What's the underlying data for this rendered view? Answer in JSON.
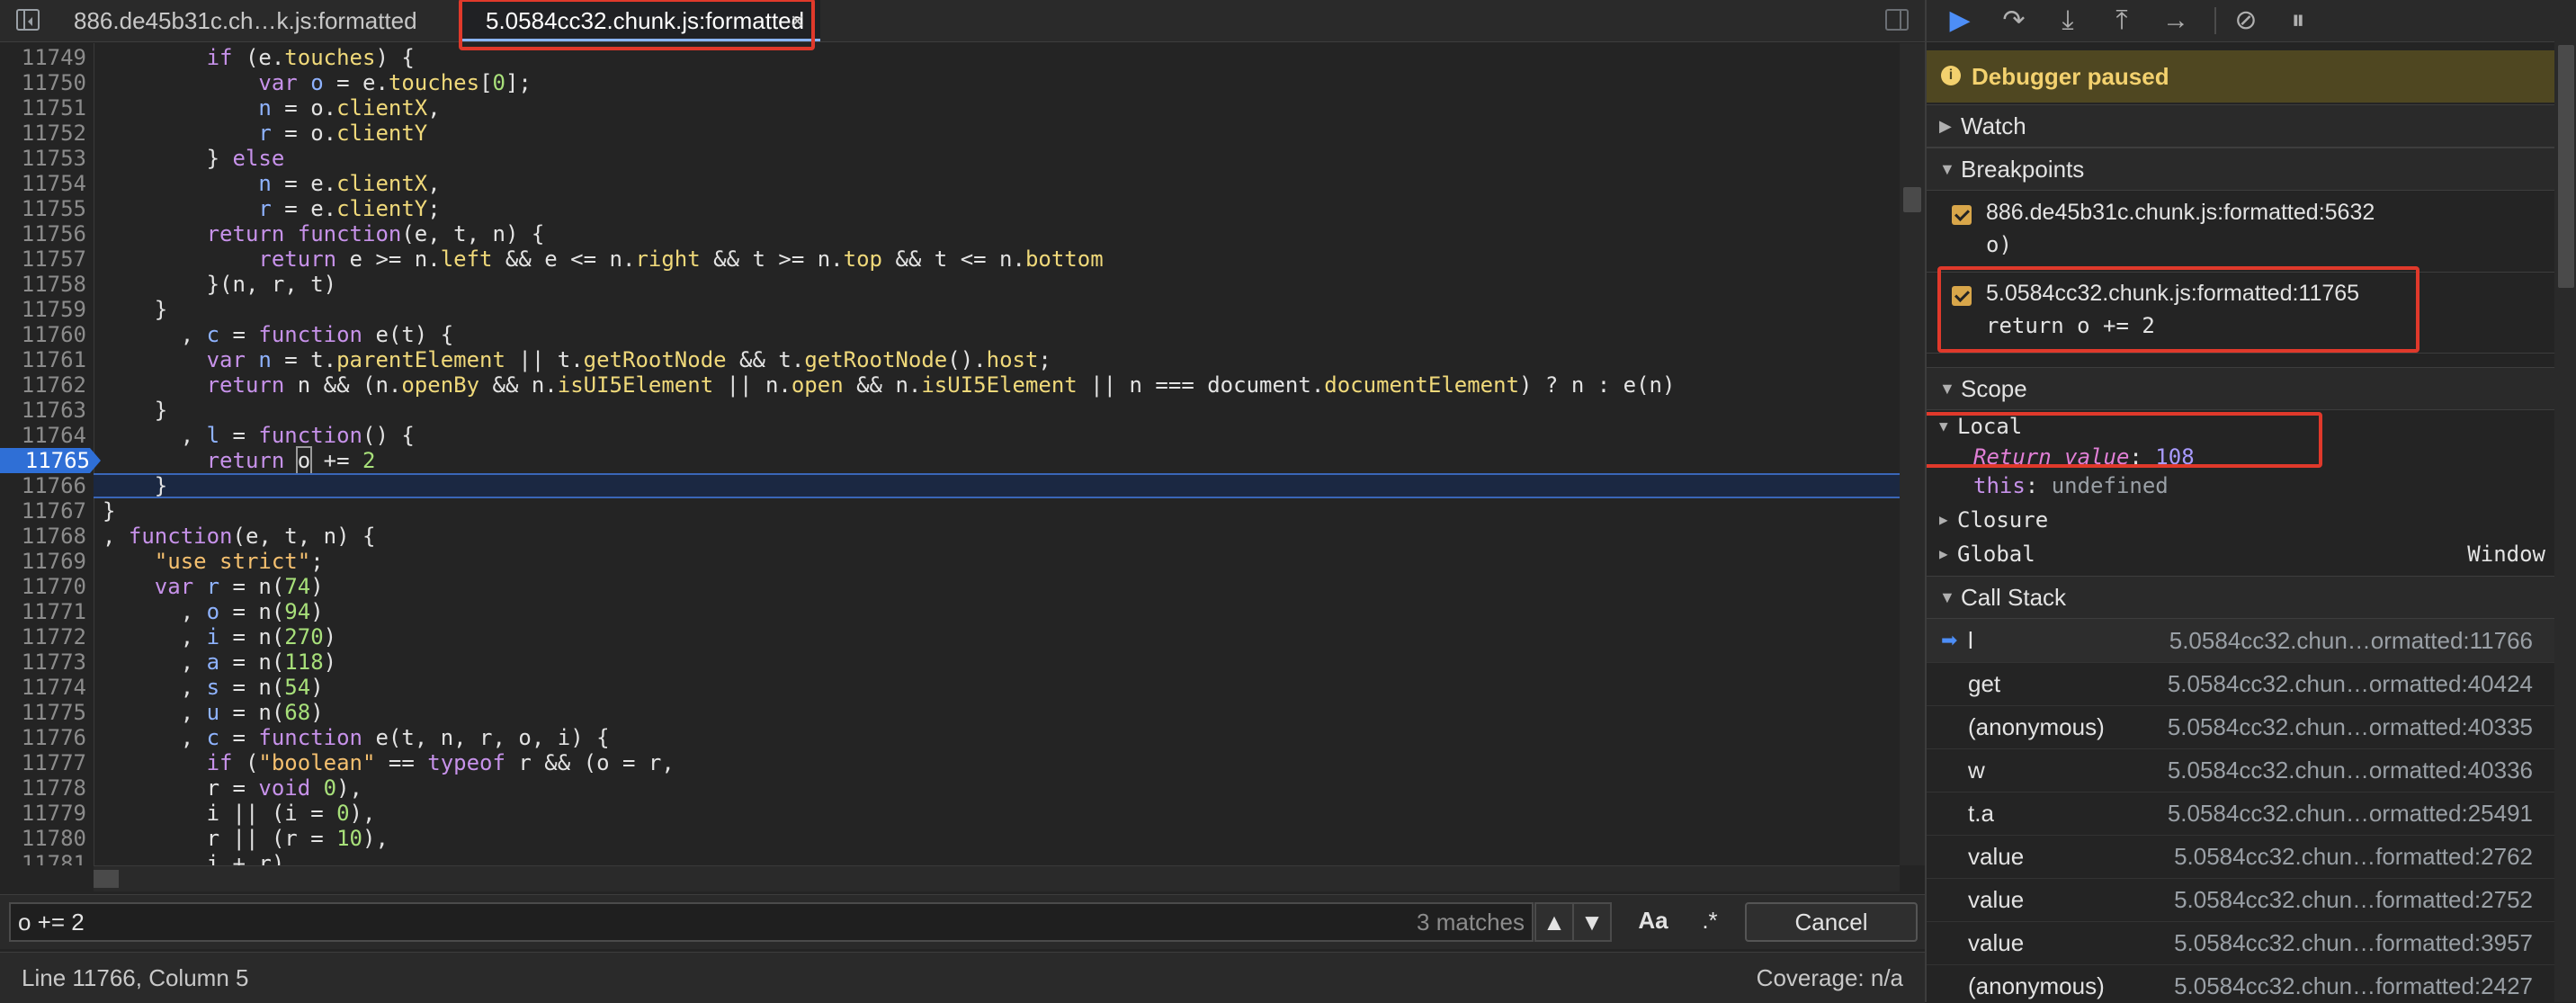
{
  "editor": {
    "tabs": [
      {
        "label": "886.de45b31c.ch…k.js:formatted"
      },
      {
        "label": "5.0584cc32.chunk.js:formatted",
        "close_label": "×"
      }
    ],
    "lines": [
      {
        "n": "11749",
        "html": "        <span class=\"kw\">if</span> (e.<span class=\"prop\">touches</span>) {"
      },
      {
        "n": "11750",
        "html": "            <span class=\"kw\">var</span> <span class=\"var\">o</span> = e.<span class=\"prop\">touches</span>[<span class=\"num\">0</span>];"
      },
      {
        "n": "11751",
        "html": "            <span class=\"var\">n</span> = o.<span class=\"prop\">clientX</span>,"
      },
      {
        "n": "11752",
        "html": "            <span class=\"var\">r</span> = o.<span class=\"prop\">clientY</span>"
      },
      {
        "n": "11753",
        "html": "        } <span class=\"kw\">else</span>"
      },
      {
        "n": "11754",
        "html": "            <span class=\"var\">n</span> = e.<span class=\"prop\">clientX</span>,"
      },
      {
        "n": "11755",
        "html": "            <span class=\"var\">r</span> = e.<span class=\"prop\">clientY</span>;"
      },
      {
        "n": "11756",
        "html": "        <span class=\"kw\">return</span> <span class=\"fn\">function</span>(e, t, n) {"
      },
      {
        "n": "11757",
        "html": "            <span class=\"kw\">return</span> e &gt;= n.<span class=\"prop\">left</span> &amp;&amp; e &lt;= n.<span class=\"prop\">right</span> &amp;&amp; t &gt;= n.<span class=\"prop\">top</span> &amp;&amp; t &lt;= n.<span class=\"prop\">bottom</span>"
      },
      {
        "n": "11758",
        "html": "        }(n, r, t)"
      },
      {
        "n": "11759",
        "html": "    }"
      },
      {
        "n": "11760",
        "html": "      , <span class=\"var\">c</span> = <span class=\"fn\">function</span> e(t) {"
      },
      {
        "n": "11761",
        "html": "        <span class=\"kw\">var</span> <span class=\"var\">n</span> = t.<span class=\"prop\">parentElement</span> || t.<span class=\"prop\">getRootNode</span> &amp;&amp; t.<span class=\"prop\">getRootNode</span>().<span class=\"prop\">host</span>;"
      },
      {
        "n": "11762",
        "html": "        <span class=\"kw\">return</span> n &amp;&amp; (n.<span class=\"prop\">openBy</span> &amp;&amp; n.<span class=\"prop\">isUI5Element</span> || n.<span class=\"prop\">open</span> &amp;&amp; n.<span class=\"prop\">isUI5Element</span> || n === document.<span class=\"prop\">documentElement</span>) ? n : e(n)"
      },
      {
        "n": "11763",
        "html": "    }"
      },
      {
        "n": "11764",
        "html": "      , <span class=\"var\">l</span> = <span class=\"fn\">function</span>() {"
      },
      {
        "n": "11765",
        "html": "        <span class=\"kw\">return</span> <span class=\"search-hit\">o</span> += <span class=\"num\">2</span>",
        "active": true
      },
      {
        "n": "11766",
        "html": "    }",
        "current": true
      },
      {
        "n": "11767",
        "html": "}"
      },
      {
        "n": "11768",
        "html": ", <span class=\"fn\">function</span>(e, t, n) {"
      },
      {
        "n": "11769",
        "html": "    <span class=\"str\">\"use strict\"</span>;"
      },
      {
        "n": "11770",
        "html": "    <span class=\"kw\">var</span> <span class=\"var\">r</span> = n(<span class=\"num\">74</span>)"
      },
      {
        "n": "11771",
        "html": "      , <span class=\"var\">o</span> = n(<span class=\"num\">94</span>)"
      },
      {
        "n": "11772",
        "html": "      , <span class=\"var\">i</span> = n(<span class=\"num\">270</span>)"
      },
      {
        "n": "11773",
        "html": "      , <span class=\"var\">a</span> = n(<span class=\"num\">118</span>)"
      },
      {
        "n": "11774",
        "html": "      , <span class=\"var\">s</span> = n(<span class=\"num\">54</span>)"
      },
      {
        "n": "11775",
        "html": "      , <span class=\"var\">u</span> = n(<span class=\"num\">68</span>)"
      },
      {
        "n": "11776",
        "html": "      , <span class=\"var\">c</span> = <span class=\"fn\">function</span> e(t, n, r, o, i) {"
      },
      {
        "n": "11777",
        "html": "        <span class=\"kw\">if</span> (<span class=\"str\">\"boolean\"</span> == <span class=\"kw\">typeof</span> r &amp;&amp; (o = r,"
      },
      {
        "n": "11778",
        "html": "        r = <span class=\"kw\">void</span> <span class=\"num\">0</span>),"
      },
      {
        "n": "11779",
        "html": "        i || (i = <span class=\"num\">0</span>),"
      },
      {
        "n": "11780",
        "html": "        r || (r = <span class=\"num\">10</span>),"
      },
      {
        "n": "11781",
        "html": "        i + r),"
      }
    ],
    "search": {
      "value": "o += 2",
      "match_count": "3 matches",
      "match_case": "Aa",
      "regex": ".*",
      "cancel": "Cancel",
      "prev": "▲",
      "next": "▼"
    },
    "status": {
      "cursor": "Line 11766, Column 5",
      "coverage": "Coverage: n/a"
    }
  },
  "debugger": {
    "toolbar": {
      "resume": "▶",
      "step_over": "↷",
      "step_into": "⤓",
      "step_out": "⤒",
      "step": "→",
      "deactivate": "⊘",
      "pause_exceptions": "⏸"
    },
    "paused_banner": "Debugger paused",
    "sections": {
      "watch": "Watch",
      "breakpoints": "Breakpoints",
      "scope": "Scope",
      "call_stack": "Call Stack"
    },
    "breakpoints": [
      {
        "file": "886.de45b31c.chunk.js:formatted:5632",
        "code": "o)"
      },
      {
        "file": "5.0584cc32.chunk.js:formatted:11765",
        "code": "return o += 2"
      }
    ],
    "scope": {
      "local": "Local",
      "return_key": "Return value",
      "return_val": "108",
      "this_key": "this",
      "this_val": "undefined",
      "closure": "Closure",
      "global": "Global",
      "global_val": "Window"
    },
    "call_stack": [
      {
        "name": "l",
        "loc": "5.0584cc32.chun…ormatted:11766"
      },
      {
        "name": "get",
        "loc": "5.0584cc32.chun…ormatted:40424"
      },
      {
        "name": "(anonymous)",
        "loc": "5.0584cc32.chun…ormatted:40335"
      },
      {
        "name": "w",
        "loc": "5.0584cc32.chun…ormatted:40336"
      },
      {
        "name": "t.a",
        "loc": "5.0584cc32.chun…ormatted:25491"
      },
      {
        "name": "value",
        "loc": "5.0584cc32.chun…formatted:2762"
      },
      {
        "name": "value",
        "loc": "5.0584cc32.chun…formatted:2752"
      },
      {
        "name": "value",
        "loc": "5.0584cc32.chun…formatted:3957"
      },
      {
        "name": "(anonymous)",
        "loc": "5.0584cc32.chun…formatted:2427"
      }
    ]
  }
}
